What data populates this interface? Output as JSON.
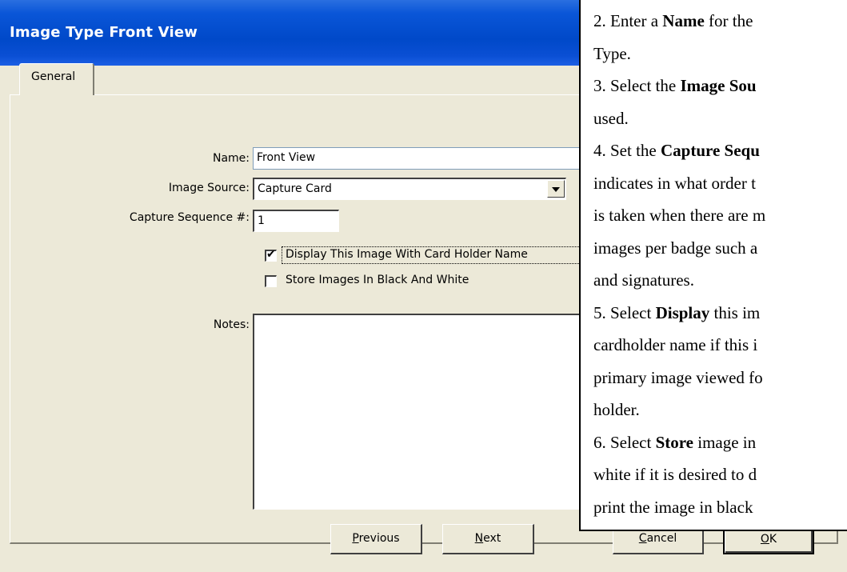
{
  "window": {
    "title": "Image Type Front View"
  },
  "tabs": [
    {
      "label": "General"
    }
  ],
  "form": {
    "name_label": "Name:",
    "name_value": "Front View",
    "image_source_label": "Image Source:",
    "image_source_value": "Capture Card",
    "capture_sequence_label": "Capture Sequence #:",
    "capture_sequence_value": "1",
    "display_checkbox": {
      "label": "Display This Image With Card Holder Name",
      "checked": true
    },
    "bw_checkbox": {
      "label": "Store Images In Black And White",
      "checked": false
    },
    "notes_label": "Notes:",
    "notes_value": ""
  },
  "buttons": {
    "previous": "Previous",
    "next": "Next",
    "cancel": "Cancel",
    "ok": "OK"
  },
  "instructions": [
    {
      "pre": "2. Enter a ",
      "bold": "Name",
      "post": " for the"
    },
    {
      "pre": "Type.",
      "bold": "",
      "post": ""
    },
    {
      "pre": "3. Select the ",
      "bold": "Image Sou",
      "post": ""
    },
    {
      "pre": "used.",
      "bold": "",
      "post": ""
    },
    {
      "pre": "4. Set the ",
      "bold": "Capture Sequ",
      "post": ""
    },
    {
      "pre": "indicates in what order t",
      "bold": "",
      "post": ""
    },
    {
      "pre": "is taken when there are m",
      "bold": "",
      "post": ""
    },
    {
      "pre": "images per badge such a",
      "bold": "",
      "post": ""
    },
    {
      "pre": "and signatures.",
      "bold": "",
      "post": ""
    },
    {
      "pre": "5. Select ",
      "bold": "Display",
      "post": " this im"
    },
    {
      "pre": "cardholder name if this i",
      "bold": "",
      "post": ""
    },
    {
      "pre": "primary image viewed fo",
      "bold": "",
      "post": ""
    },
    {
      "pre": "holder.",
      "bold": "",
      "post": ""
    },
    {
      "pre": "6. Select ",
      "bold": "Store",
      "post": " image in"
    },
    {
      "pre": "white if it is desired to d",
      "bold": "",
      "post": ""
    },
    {
      "pre": "print the image in black",
      "bold": "",
      "post": ""
    }
  ]
}
